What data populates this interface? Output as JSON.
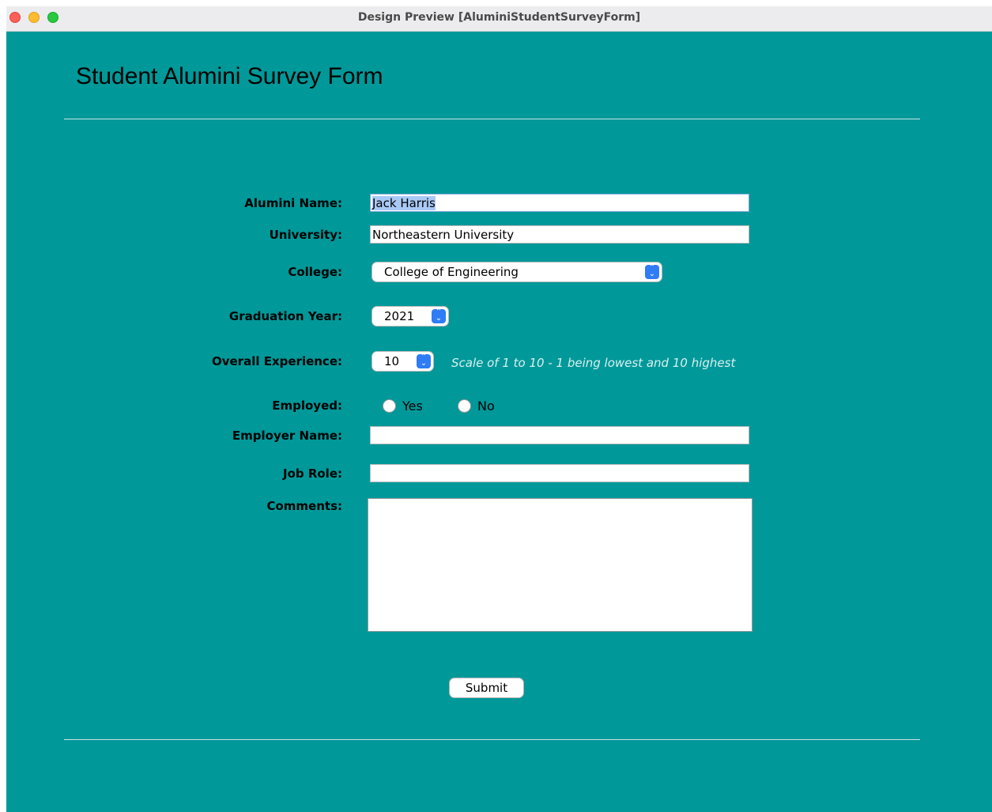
{
  "window": {
    "title": "Design Preview [AluminiStudentSurveyForm]",
    "background_color": "#009899"
  },
  "form": {
    "heading": "Student Alumini Survey Form",
    "alumni_name": {
      "label": "Alumini Name:",
      "value": "Jack Harris"
    },
    "university": {
      "label": "University:",
      "value": "Northeastern University"
    },
    "college": {
      "label": "College:",
      "selected": "College of Engineering"
    },
    "graduation_year": {
      "label": "Graduation Year:",
      "selected": "2021"
    },
    "overall_experience": {
      "label": "Overall Experience:",
      "selected": "10",
      "hint": "Scale of 1 to 10 - 1 being lowest and 10 highest"
    },
    "employed": {
      "label": "Employed:",
      "options": [
        "Yes",
        "No"
      ]
    },
    "employer_name": {
      "label": "Employer Name:",
      "value": ""
    },
    "job_role": {
      "label": "Job Role:",
      "value": ""
    },
    "comments": {
      "label": "Comments:",
      "value": ""
    },
    "submit_label": "Submit"
  },
  "icons": {
    "select_arrow": "up-down-chevron-icon",
    "radio": "radio-unchecked-icon"
  }
}
